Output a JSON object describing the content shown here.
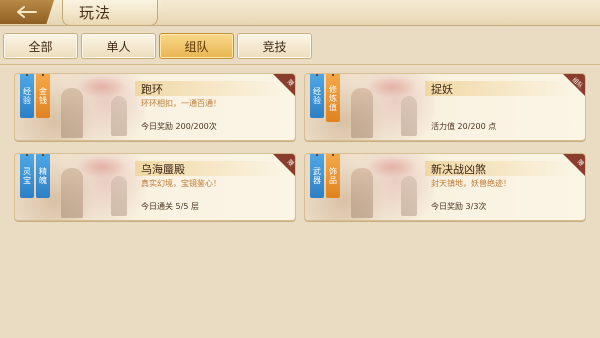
{
  "header": {
    "title": "玩法"
  },
  "tabs": [
    {
      "label": "全部"
    },
    {
      "label": "单人"
    },
    {
      "label": "组队"
    },
    {
      "label": "竞技"
    }
  ],
  "cards": [
    {
      "name": "跑环",
      "desc": "环环相扣，一通百通！",
      "stat": "今日奖励 200/200次",
      "banners": [
        "经验",
        "金钱"
      ],
      "corner": "限",
      "corner_color": "#8a3d2c"
    },
    {
      "name": "捉妖",
      "desc": "",
      "stat": "活力值 20/200 点",
      "banners": [
        "经验",
        "修炼值"
      ],
      "corner": "组队",
      "corner_color": "#8a3d2c"
    },
    {
      "name": "乌海蜃殿",
      "desc": "真实幻境，宝镜鉴心！",
      "stat": "今日通关 5/5 层",
      "banners": [
        "灵宝",
        "精魄"
      ],
      "corner": "限",
      "corner_color": "#8a3d2c"
    },
    {
      "name": "新决战凶煞",
      "desc": "封天镇地，妖兽绝迹！",
      "stat": "今日奖励 3/3次",
      "banners": [
        "武器",
        "饰品"
      ],
      "corner": "限",
      "corner_color": "#8a3d2c"
    }
  ],
  "colors": {
    "active_tab": "#e8b551",
    "banner_blue": "#2e7fc4",
    "banner_orange": "#e08320",
    "desc_text": "#c07a34"
  }
}
